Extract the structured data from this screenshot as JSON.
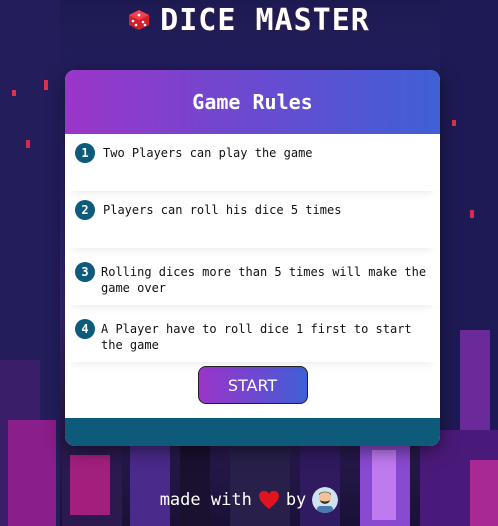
{
  "app": {
    "title": "DICE MASTER"
  },
  "card": {
    "title": "Game Rules",
    "rules": [
      {
        "num": "1",
        "text": "Two Players can play the game"
      },
      {
        "num": "2",
        "text": "Players can roll his dice 5 times"
      },
      {
        "num": "3",
        "text": "Rolling dices more than 5 times will make the game over"
      },
      {
        "num": "4",
        "text": "A Player have to roll dice 1 first to start the game"
      }
    ],
    "start_label": "START"
  },
  "footer": {
    "made_with": "made with",
    "by": "by"
  },
  "icons": {
    "title_icon": "die-icon",
    "heart": "heart-icon",
    "avatar": "developer-avatar"
  },
  "colors": {
    "accent_start": "#9b35c9",
    "accent_end": "#3f60d6",
    "teal": "#0e5a7a",
    "heart": "#e0141e"
  }
}
